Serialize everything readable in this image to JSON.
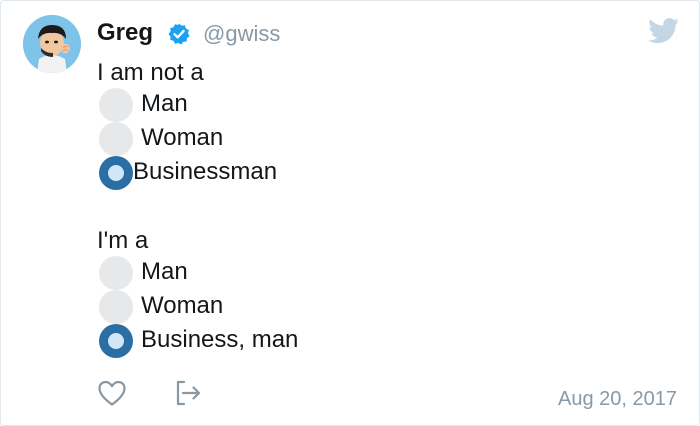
{
  "tweet": {
    "author_name": "Greg",
    "author_handle": "@gwiss",
    "date": "Aug 20, 2017",
    "poll1": {
      "prompt": "I am not a",
      "options": [
        {
          "label": "Man",
          "selected": false
        },
        {
          "label": "Woman",
          "selected": false
        },
        {
          "label": "Businessman",
          "selected": true
        }
      ]
    },
    "poll2": {
      "prompt": "I'm a",
      "options": [
        {
          "label": "Man",
          "selected": false
        },
        {
          "label": "Woman",
          "selected": false
        },
        {
          "label": "Business, man",
          "selected": true
        }
      ]
    }
  },
  "icons": {
    "verified": "verified-badge-icon",
    "brand": "twitter-bird-icon",
    "like": "heart-icon",
    "share": "share-icon"
  },
  "colors": {
    "accent": "#1da1f2",
    "radio_selected": "#2a6ea3",
    "radio_unselected": "#e6e8ea",
    "muted_text": "#8899a6"
  }
}
